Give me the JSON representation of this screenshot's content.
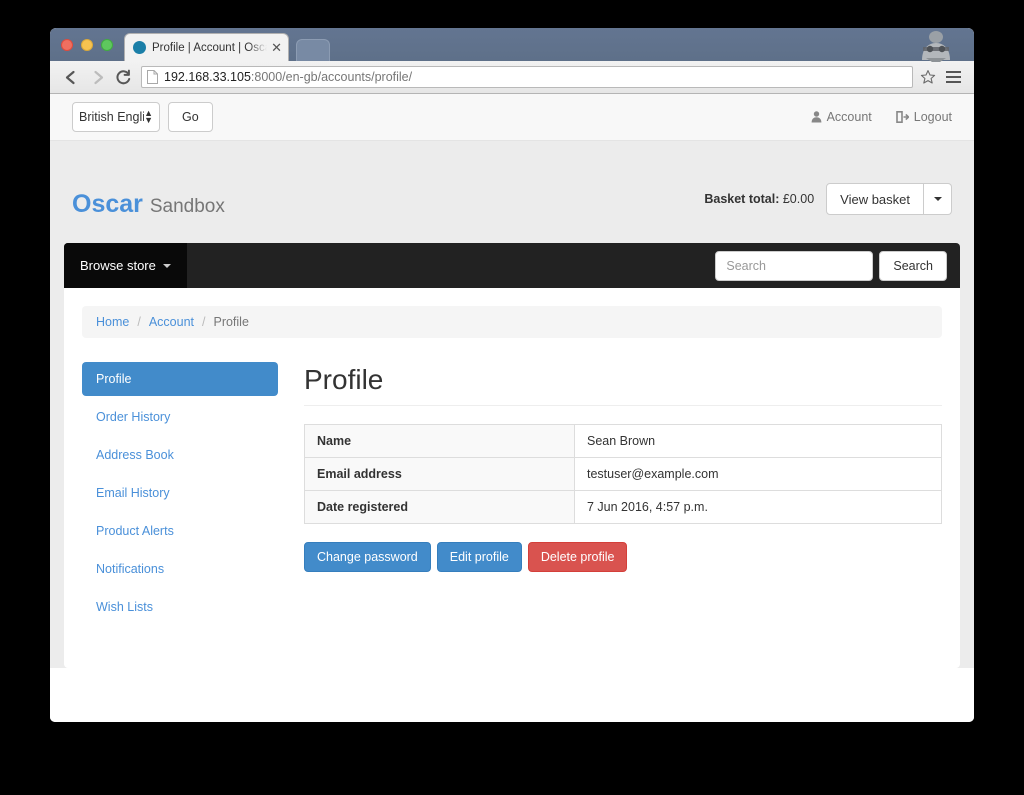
{
  "browser": {
    "tab_title": "Profile | Account | Oscar - S",
    "tab_close_glyph": "✕",
    "url_host": "192.168.33.105",
    "url_path": ":8000/en-gb/accounts/profile/",
    "back_glyph": "←",
    "forward_glyph": "→",
    "reload_glyph": "C",
    "star_glyph": "☆"
  },
  "lang_bar": {
    "selected_language": "British Engli",
    "go_label": "Go",
    "account_label": "Account",
    "logout_label": "Logout"
  },
  "site_header": {
    "brand_primary": "Oscar",
    "brand_secondary": "Sandbox",
    "basket_label": "Basket total:",
    "basket_amount": "£0.00",
    "view_basket_label": "View basket"
  },
  "navbar": {
    "browse_store_label": "Browse store",
    "search_placeholder": "Search",
    "search_button_label": "Search"
  },
  "breadcrumb": {
    "home": "Home",
    "account": "Account",
    "separator": "/",
    "current": "Profile"
  },
  "account_nav": {
    "items": [
      {
        "label": "Profile",
        "active": true
      },
      {
        "label": "Order History",
        "active": false
      },
      {
        "label": "Address Book",
        "active": false
      },
      {
        "label": "Email History",
        "active": false
      },
      {
        "label": "Product Alerts",
        "active": false
      },
      {
        "label": "Notifications",
        "active": false
      },
      {
        "label": "Wish Lists",
        "active": false
      }
    ]
  },
  "main": {
    "page_title": "Profile",
    "rows": [
      {
        "key": "Name",
        "value": "Sean Brown"
      },
      {
        "key": "Email address",
        "value": "testuser@example.com"
      },
      {
        "key": "Date registered",
        "value": "7 Jun 2016, 4:57 p.m."
      }
    ],
    "buttons": {
      "change_password": "Change password",
      "edit_profile": "Edit profile",
      "delete_profile": "Delete profile"
    }
  },
  "colors": {
    "brand_blue": "#4a90d9",
    "primary_button": "#428bca",
    "danger_button": "#d9534f",
    "navbar_black": "#222222",
    "page_background": "#ececec"
  }
}
